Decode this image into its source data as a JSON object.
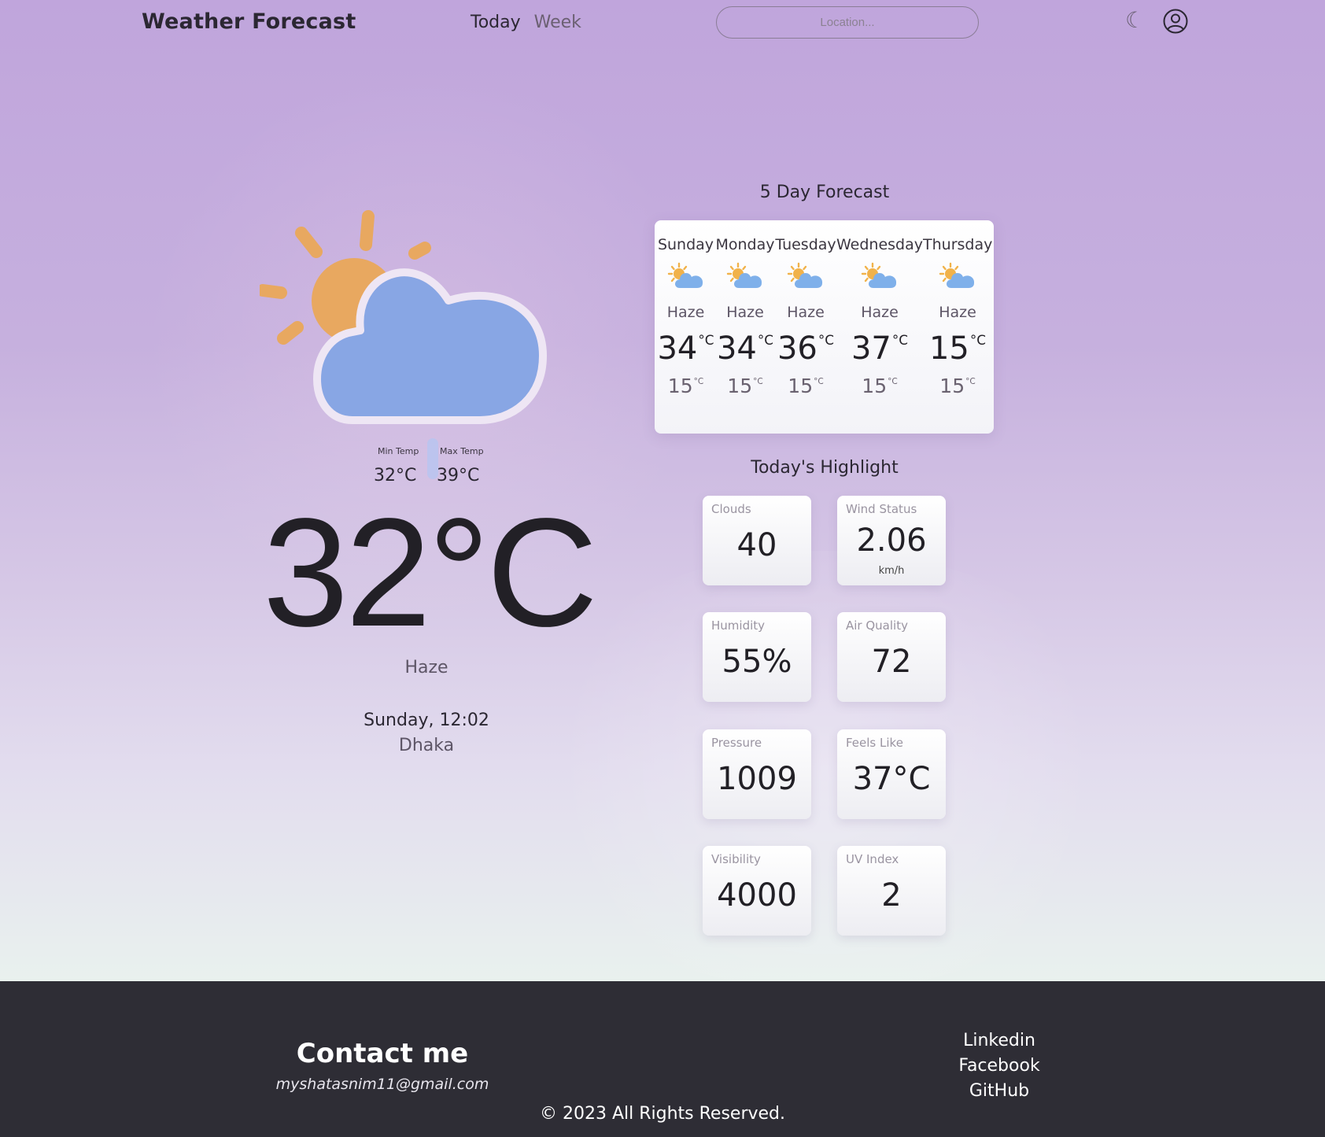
{
  "header": {
    "brand": "Weather Forecast",
    "nav": {
      "today": "Today",
      "week": "Week"
    },
    "search_placeholder": "Location..."
  },
  "current": {
    "min_temp_label": "Min Temp",
    "max_temp_label": "Max Temp",
    "min_temp": "32°C",
    "max_temp": "39°C",
    "temperature": "32°C",
    "condition": "Haze",
    "datetime": "Sunday, 12:02",
    "city": "Dhaka",
    "icon": "sun-behind-cloud-icon"
  },
  "forecast": {
    "title": "5 Day Forecast",
    "unit": "°C",
    "days": [
      {
        "day": "Sunday",
        "condition": "Haze",
        "max": "34",
        "min": "15"
      },
      {
        "day": "Monday",
        "condition": "Haze",
        "max": "34",
        "min": "15"
      },
      {
        "day": "Tuesday",
        "condition": "Haze",
        "max": "36",
        "min": "15"
      },
      {
        "day": "Wednesday",
        "condition": "Haze",
        "max": "37",
        "min": "15"
      },
      {
        "day": "Thursday",
        "condition": "Haze",
        "max": "15",
        "min": "15"
      }
    ]
  },
  "highlights": {
    "title": "Today's Highlight",
    "items": [
      {
        "label": "Clouds",
        "value": "40",
        "unit": ""
      },
      {
        "label": "Wind Status",
        "value": "2.06",
        "unit": "km/h"
      },
      {
        "label": "Humidity",
        "value": "55%",
        "unit": ""
      },
      {
        "label": "Air Quality",
        "value": "72",
        "unit": ""
      },
      {
        "label": "Pressure",
        "value": "1009",
        "unit": ""
      },
      {
        "label": "Feels Like",
        "value": "37°C",
        "unit": ""
      },
      {
        "label": "Visibility",
        "value": "4000",
        "unit": ""
      },
      {
        "label": "UV Index",
        "value": "2",
        "unit": ""
      }
    ]
  },
  "footer": {
    "contact_title": "Contact me",
    "email": "myshatasnim11@gmail.com",
    "links": [
      "Linkedin",
      "Facebook",
      "GitHub"
    ],
    "copyright": "© 2023 All Rights Reserved."
  },
  "colors": {
    "background_top": "#c0a5dc",
    "background_bottom": "#e9f1ee",
    "footer": "#2e2d35",
    "sun": "#e8a860",
    "cloud": "#88a6e4"
  }
}
